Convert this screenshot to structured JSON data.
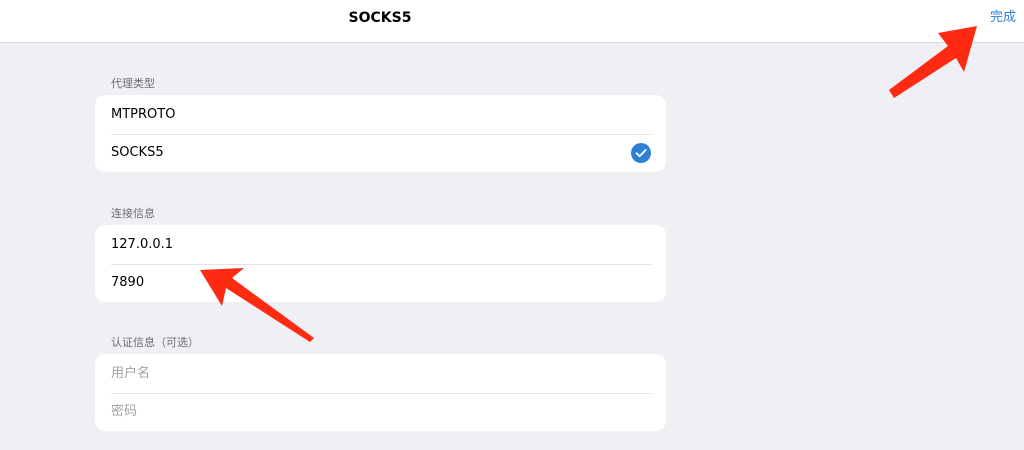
{
  "nav": {
    "title": "SOCKS5",
    "done_label": "完成"
  },
  "proxy_type": {
    "header": "代理类型",
    "options": [
      {
        "label": "MTPROTO",
        "selected": false
      },
      {
        "label": "SOCKS5",
        "selected": true
      }
    ]
  },
  "connection": {
    "header": "连接信息",
    "server": "127.0.0.1",
    "port": "7890"
  },
  "auth": {
    "header": "认证信息（可选）",
    "username_placeholder": "用户名",
    "password_placeholder": "密码"
  },
  "icons": {
    "check": "checkmark-circle-icon",
    "arrow": "annotation-arrow-icon"
  },
  "colors": {
    "accent": "#2f7fd6",
    "arrow": "#ff2a12",
    "background": "#efeff4"
  }
}
